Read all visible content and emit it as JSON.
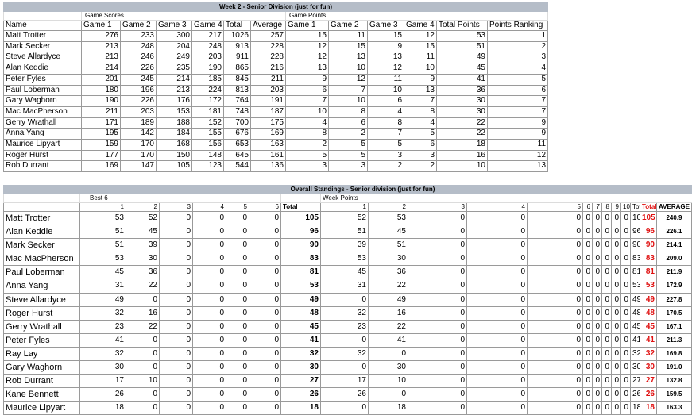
{
  "week_table": {
    "title": "Week 2 - Senior Division (just for fun)",
    "group_scores": "Game Scores",
    "group_points": "Game Points",
    "headers": [
      "Name",
      "Game 1",
      "Game 2",
      "Game 3",
      "Game 4",
      "Total",
      "Average",
      "Game 1",
      "Game 2",
      "Game 3",
      "Game 4",
      "Total Points",
      "Points Ranking"
    ],
    "rows": [
      [
        "Matt Trotter",
        "276",
        "233",
        "300",
        "217",
        "1026",
        "257",
        "15",
        "11",
        "15",
        "12",
        "53",
        "1"
      ],
      [
        "Mark Secker",
        "213",
        "248",
        "204",
        "248",
        "913",
        "228",
        "12",
        "15",
        "9",
        "15",
        "51",
        "2"
      ],
      [
        "Steve Allardyce",
        "213",
        "246",
        "249",
        "203",
        "911",
        "228",
        "12",
        "13",
        "13",
        "11",
        "49",
        "3"
      ],
      [
        "Alan Keddie",
        "214",
        "226",
        "235",
        "190",
        "865",
        "216",
        "13",
        "10",
        "12",
        "10",
        "45",
        "4"
      ],
      [
        "Peter Fyles",
        "201",
        "245",
        "214",
        "185",
        "845",
        "211",
        "9",
        "12",
        "11",
        "9",
        "41",
        "5"
      ],
      [
        "Paul Loberman",
        "180",
        "196",
        "213",
        "224",
        "813",
        "203",
        "6",
        "7",
        "10",
        "13",
        "36",
        "6"
      ],
      [
        "Gary Waghorn",
        "190",
        "226",
        "176",
        "172",
        "764",
        "191",
        "7",
        "10",
        "6",
        "7",
        "30",
        "7"
      ],
      [
        "Mac MacPherson",
        "211",
        "203",
        "153",
        "181",
        "748",
        "187",
        "10",
        "8",
        "4",
        "8",
        "30",
        "7"
      ],
      [
        "Gerry Wrathall",
        "171",
        "189",
        "188",
        "152",
        "700",
        "175",
        "4",
        "6",
        "8",
        "4",
        "22",
        "9"
      ],
      [
        "Anna Yang",
        "195",
        "142",
        "184",
        "155",
        "676",
        "169",
        "8",
        "2",
        "7",
        "5",
        "22",
        "9"
      ],
      [
        "Maurice Lipyart",
        "159",
        "170",
        "168",
        "156",
        "653",
        "163",
        "2",
        "5",
        "5",
        "6",
        "18",
        "11"
      ],
      [
        "Roger Hurst",
        "177",
        "170",
        "150",
        "148",
        "645",
        "161",
        "5",
        "5",
        "3",
        "3",
        "16",
        "12"
      ],
      [
        "Rob Durrant",
        "169",
        "147",
        "105",
        "123",
        "544",
        "136",
        "3",
        "3",
        "2",
        "2",
        "10",
        "13"
      ]
    ]
  },
  "standings_table": {
    "title": "Overall Standings - Senior division (just for fun)",
    "best6_label": "Best 6",
    "week_points_label": "Week Points",
    "total_label": "Total",
    "total_points_label": "Total points",
    "average_label": "AVERAGE",
    "cols": [
      "1",
      "2",
      "3",
      "4",
      "5",
      "6",
      "1",
      "2",
      "3",
      "4",
      "5",
      "6",
      "7",
      "8",
      "9",
      "10"
    ],
    "rows": [
      {
        "name": "Matt Trotter",
        "best": [
          "53",
          "52",
          "0",
          "0",
          "0",
          "0"
        ],
        "total": "105",
        "weeks": [
          "52",
          "53",
          "0",
          "0",
          "0",
          "0",
          "0",
          "0",
          "0",
          "0"
        ],
        "wtotal": "105",
        "tp": "105",
        "avg": "240.9"
      },
      {
        "name": "Alan Keddie",
        "best": [
          "51",
          "45",
          "0",
          "0",
          "0",
          "0"
        ],
        "total": "96",
        "weeks": [
          "51",
          "45",
          "0",
          "0",
          "0",
          "0",
          "0",
          "0",
          "0",
          "0"
        ],
        "wtotal": "96",
        "tp": "96",
        "avg": "226.1"
      },
      {
        "name": "Mark Secker",
        "best": [
          "51",
          "39",
          "0",
          "0",
          "0",
          "0"
        ],
        "total": "90",
        "weeks": [
          "39",
          "51",
          "0",
          "0",
          "0",
          "0",
          "0",
          "0",
          "0",
          "0"
        ],
        "wtotal": "90",
        "tp": "90",
        "avg": "214.1"
      },
      {
        "name": "Mac MacPherson",
        "best": [
          "53",
          "30",
          "0",
          "0",
          "0",
          "0"
        ],
        "total": "83",
        "weeks": [
          "53",
          "30",
          "0",
          "0",
          "0",
          "0",
          "0",
          "0",
          "0",
          "0"
        ],
        "wtotal": "83",
        "tp": "83",
        "avg": "209.0"
      },
      {
        "name": "Paul Loberman",
        "best": [
          "45",
          "36",
          "0",
          "0",
          "0",
          "0"
        ],
        "total": "81",
        "weeks": [
          "45",
          "36",
          "0",
          "0",
          "0",
          "0",
          "0",
          "0",
          "0",
          "0"
        ],
        "wtotal": "81",
        "tp": "81",
        "avg": "211.9"
      },
      {
        "name": "Anna Yang",
        "best": [
          "31",
          "22",
          "0",
          "0",
          "0",
          "0"
        ],
        "total": "53",
        "weeks": [
          "31",
          "22",
          "0",
          "0",
          "0",
          "0",
          "0",
          "0",
          "0",
          "0"
        ],
        "wtotal": "53",
        "tp": "53",
        "avg": "172.9"
      },
      {
        "name": "Steve Allardyce",
        "best": [
          "49",
          "0",
          "0",
          "0",
          "0",
          "0"
        ],
        "total": "49",
        "weeks": [
          "0",
          "49",
          "0",
          "0",
          "0",
          "0",
          "0",
          "0",
          "0",
          "0"
        ],
        "wtotal": "49",
        "tp": "49",
        "avg": "227.8"
      },
      {
        "name": "Roger Hurst",
        "best": [
          "32",
          "16",
          "0",
          "0",
          "0",
          "0"
        ],
        "total": "48",
        "weeks": [
          "32",
          "16",
          "0",
          "0",
          "0",
          "0",
          "0",
          "0",
          "0",
          "0"
        ],
        "wtotal": "48",
        "tp": "48",
        "avg": "170.5"
      },
      {
        "name": "Gerry Wrathall",
        "best": [
          "23",
          "22",
          "0",
          "0",
          "0",
          "0"
        ],
        "total": "45",
        "weeks": [
          "23",
          "22",
          "0",
          "0",
          "0",
          "0",
          "0",
          "0",
          "0",
          "0"
        ],
        "wtotal": "45",
        "tp": "45",
        "avg": "167.1"
      },
      {
        "name": "Peter Fyles",
        "best": [
          "41",
          "0",
          "0",
          "0",
          "0",
          "0"
        ],
        "total": "41",
        "weeks": [
          "0",
          "41",
          "0",
          "0",
          "0",
          "0",
          "0",
          "0",
          "0",
          "0"
        ],
        "wtotal": "41",
        "tp": "41",
        "avg": "211.3"
      },
      {
        "name": "Ray Lay",
        "best": [
          "32",
          "0",
          "0",
          "0",
          "0",
          "0"
        ],
        "total": "32",
        "weeks": [
          "32",
          "0",
          "0",
          "0",
          "0",
          "0",
          "0",
          "0",
          "0",
          "0"
        ],
        "wtotal": "32",
        "tp": "32",
        "avg": "169.8"
      },
      {
        "name": "Gary Waghorn",
        "best": [
          "30",
          "0",
          "0",
          "0",
          "0",
          "0"
        ],
        "total": "30",
        "weeks": [
          "0",
          "30",
          "0",
          "0",
          "0",
          "0",
          "0",
          "0",
          "0",
          "0"
        ],
        "wtotal": "30",
        "tp": "30",
        "avg": "191.0"
      },
      {
        "name": "Rob Durrant",
        "best": [
          "17",
          "10",
          "0",
          "0",
          "0",
          "0"
        ],
        "total": "27",
        "weeks": [
          "17",
          "10",
          "0",
          "0",
          "0",
          "0",
          "0",
          "0",
          "0",
          "0"
        ],
        "wtotal": "27",
        "tp": "27",
        "avg": "132.8"
      },
      {
        "name": "Kane Bennett",
        "best": [
          "26",
          "0",
          "0",
          "0",
          "0",
          "0"
        ],
        "total": "26",
        "weeks": [
          "26",
          "0",
          "0",
          "0",
          "0",
          "0",
          "0",
          "0",
          "0",
          "0"
        ],
        "wtotal": "26",
        "tp": "26",
        "avg": "159.5"
      },
      {
        "name": "Maurice Lipyart",
        "best": [
          "18",
          "0",
          "0",
          "0",
          "0",
          "0"
        ],
        "total": "18",
        "weeks": [
          "0",
          "18",
          "0",
          "0",
          "0",
          "0",
          "0",
          "0",
          "0",
          "0"
        ],
        "wtotal": "18",
        "tp": "18",
        "avg": "163.3"
      }
    ]
  }
}
